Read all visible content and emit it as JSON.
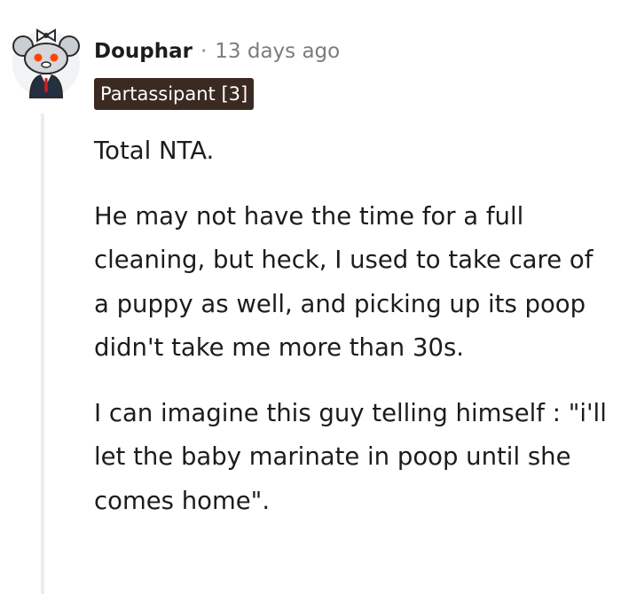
{
  "comment": {
    "author": "Douphar",
    "separator": "·",
    "timestamp": "13 days ago",
    "flair": "Partassipant [3]",
    "avatar_icon": "snoo-avatar-icon",
    "paragraphs": [
      "Total NTA.",
      "He may not have the time for a full cleaning, but heck, I used to take care of a puppy as well, and picking up its poop didn't take me more than 30s.",
      "I can imagine this guy telling himself : \"i'll let the baby marinate in poop until she comes home\"."
    ]
  },
  "colors": {
    "flair_bg": "#3a2a22",
    "meta_text": "#7c7c7c",
    "thread_line": "#e9edf0"
  }
}
